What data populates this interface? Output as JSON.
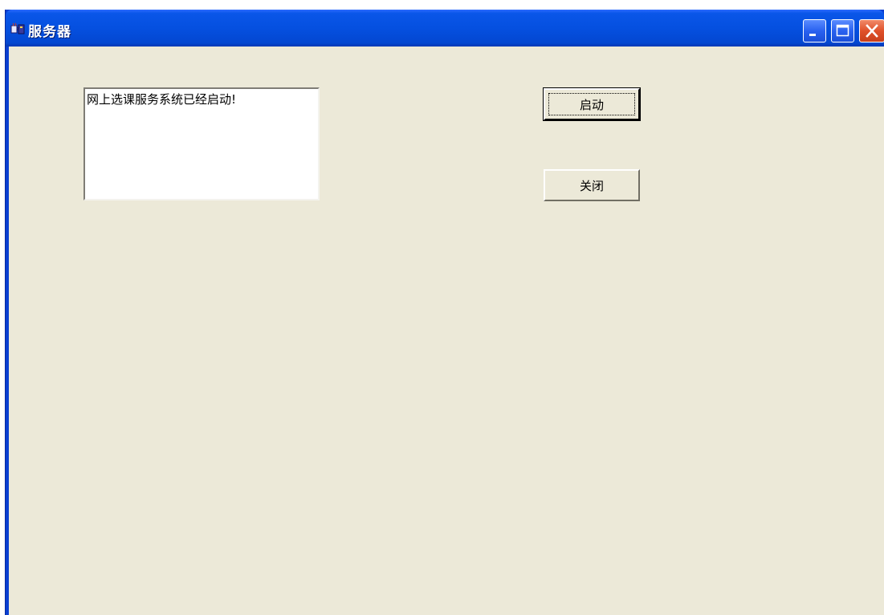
{
  "window": {
    "title": "服务器",
    "icon": "java-cup-icon",
    "controls": {
      "minimize": "minimize-icon",
      "maximize": "maximize-icon",
      "close": "close-icon"
    }
  },
  "log": {
    "text": "网上选课服务系统已经启动!"
  },
  "buttons": {
    "start_label": "启动",
    "close_label": "关闭"
  },
  "colors": {
    "titlebar": "#0550e0",
    "client_background": "#ece9d8",
    "close_button": "#e0512a"
  }
}
